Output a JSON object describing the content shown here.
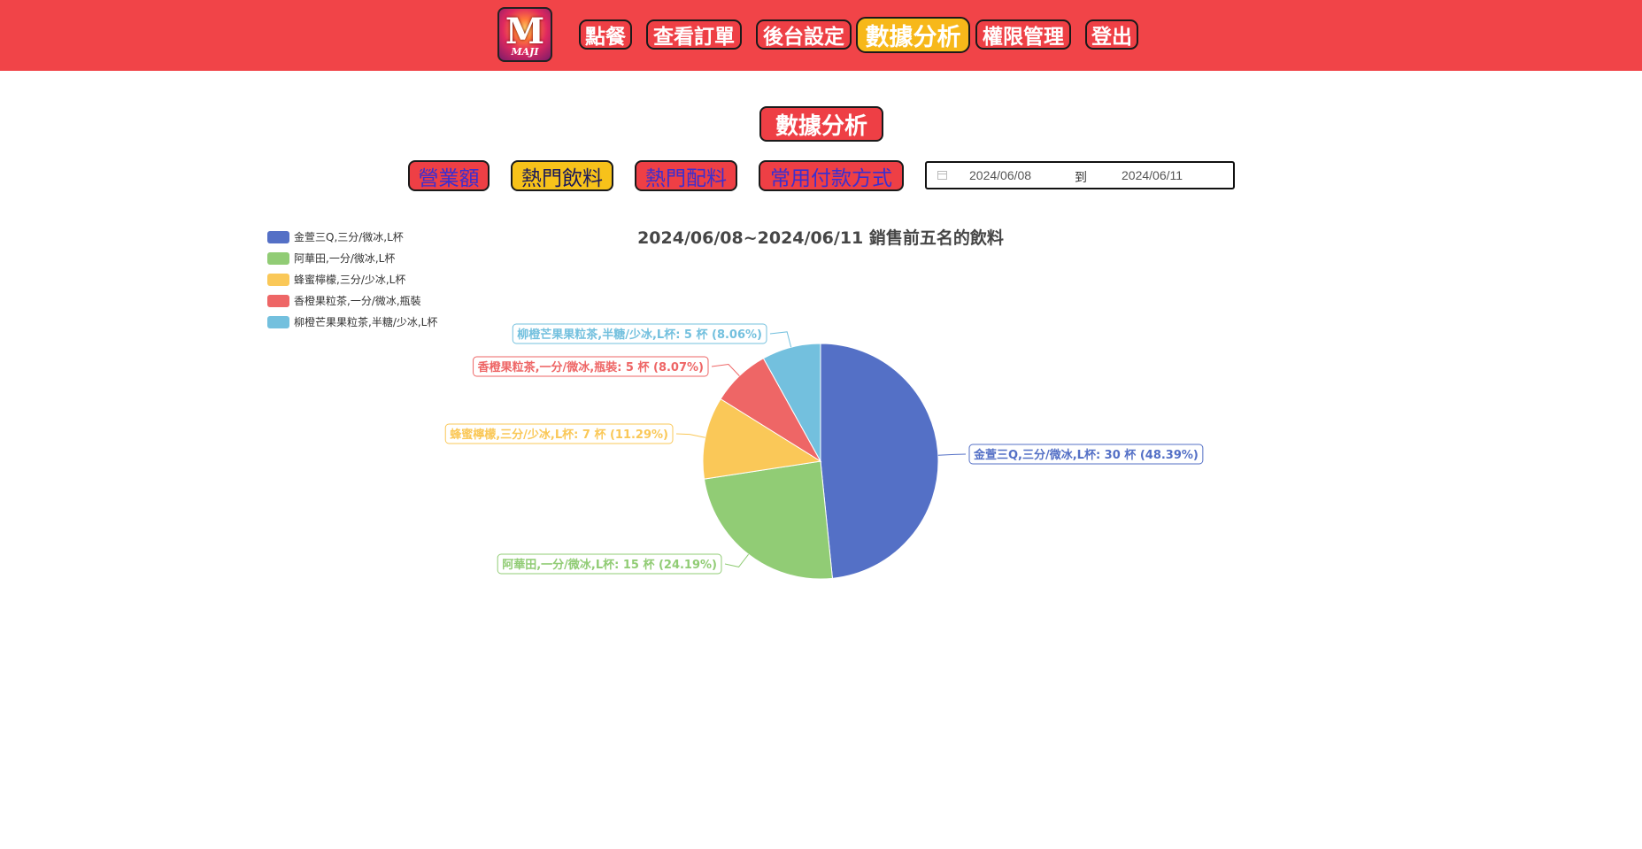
{
  "nav": {
    "logo_text": "M",
    "logo_sub": "MAJI",
    "items": [
      {
        "label": "點餐",
        "active": false
      },
      {
        "label": "查看訂單",
        "active": false
      },
      {
        "label": "後台設定",
        "active": false
      },
      {
        "label": "數據分析",
        "active": true
      },
      {
        "label": "權限管理",
        "active": false
      },
      {
        "label": "登出",
        "active": false
      }
    ]
  },
  "page": {
    "title": "數據分析",
    "tabs": [
      {
        "label": "營業額",
        "active": false
      },
      {
        "label": "熱門飲料",
        "active": true
      },
      {
        "label": "熱門配料",
        "active": false
      },
      {
        "label": "常用付款方式",
        "active": false
      }
    ],
    "date_start": "2024/06/08",
    "date_separator": "到",
    "date_end": "2024/06/11"
  },
  "colors": {
    "topbar": "#f14448",
    "button_red": "#ee3f45",
    "button_active": "#f7b81a"
  },
  "chart_data": {
    "type": "pie",
    "title": "2024/06/08~2024/06/11 銷售前五名的飲料",
    "legend_position": "top-left",
    "unit": "杯",
    "slices": [
      {
        "name": "金萱三Q,三分/微冰,L杯",
        "value": 30,
        "percent": "48.39%",
        "color": "#5470c6",
        "label": "金萱三Q,三分/微冰,L杯: 30 杯 (48.39%)"
      },
      {
        "name": "阿華田,一分/微冰,L杯",
        "value": 15,
        "percent": "24.19%",
        "color": "#91cc75",
        "label": "阿華田,一分/微冰,L杯: 15 杯 (24.19%)"
      },
      {
        "name": "蜂蜜檸檬,三分/少冰,L杯",
        "value": 7,
        "percent": "11.29%",
        "color": "#fac858",
        "label": "蜂蜜檸檬,三分/少冰,L杯: 7 杯 (11.29%)"
      },
      {
        "name": "香橙果粒茶,一分/微冰,瓶裝",
        "value": 5,
        "percent": "8.07%",
        "color": "#ee6666",
        "label": "香橙果粒茶,一分/微冰,瓶裝: 5 杯 (8.07%)"
      },
      {
        "name": "柳橙芒果果粒茶,半糖/少冰,L杯",
        "value": 5,
        "percent": "8.06%",
        "color": "#73c0de",
        "label": "柳橙芒果果粒茶,半糖/少冰,L杯: 5 杯 (8.06%)"
      }
    ]
  }
}
